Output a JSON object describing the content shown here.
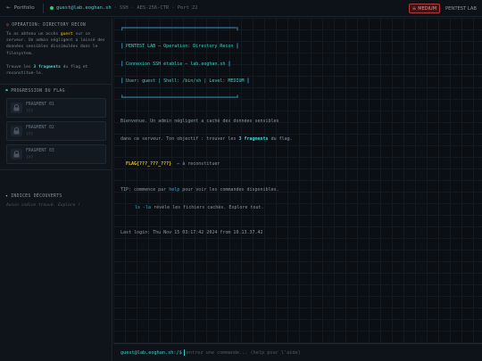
{
  "topbar": {
    "back_label": "Portfolio",
    "connection_user": "guest@lab.eoghan.sh",
    "connection_info": "SSH · AES-256-CTR · Port 22",
    "difficulty": "MEDIUM",
    "lab_label": "PENTEST LAB"
  },
  "sidebar": {
    "mission": {
      "title": "OPERATION: DIRECTORY RECON",
      "line1_pre": "Tu as obtenu un accès ",
      "line1_hl": "guest",
      "line1_post": " sur ce",
      "line2": "serveur. Un admin négligent a laissé des",
      "line3": "données sensibles dissimulées dans le",
      "line4": "filesystem.",
      "obj_pre": "Trouve les ",
      "obj_hl": "3 fragments",
      "obj_post": " du flag et",
      "obj_line2": "reconstitue-le."
    },
    "progress_title": "PROGRESSION DU FLAG",
    "fragments": [
      {
        "name": "FRAGMENT 01",
        "value": "???"
      },
      {
        "name": "FRAGMENT 02",
        "value": "???"
      },
      {
        "name": "FRAGMENT 03",
        "value": "???"
      }
    ],
    "clues_title": "INDICES DÉCOUVERTS",
    "clues_empty": "Aucun indice trouvé. Explore !"
  },
  "terminal": {
    "banner_top": "╔══════════════════════════════════════════╗",
    "banner_line1": "PENTEST LAB — Operation: Directory Recon",
    "banner_line2": "Connexion SSH établie — lab.eoghan.sh",
    "banner_line3": "User: guest | Shell: /bin/sh | Level: MEDIUM",
    "banner_bottom": "╚══════════════════════════════════════════╝",
    "welcome1": "Bienvenue. Un admin négligent a caché des données sensibles",
    "welcome2_pre": "dans ce serveur. Ton objectif : trouver les ",
    "welcome2_hl": "3 fragments",
    "welcome2_post": " du flag.",
    "flag_template": "FLAG{???_???_???}",
    "flag_suffix": "← à reconstituer",
    "tip_pre": "TIP: commence par ",
    "tip_cmd": "help",
    "tip_post": " pour voir les commandes disponibles.",
    "ls_cmd": "ls -la",
    "ls_desc": " révèle les fichiers cachés. Explore tout.",
    "last_login": "Last login: Thu Nov 15 03:17:42 2024 from 10.13.37.42"
  },
  "input": {
    "prompt": "guest@lab.eoghan.sh:/$",
    "placeholder": "entrez une commande... (help pour l'aide)"
  },
  "colors": {
    "accent": "#3bd1c6",
    "flag": "#f1c40f",
    "danger": "#b23a3a",
    "background": "#0b0f14"
  }
}
